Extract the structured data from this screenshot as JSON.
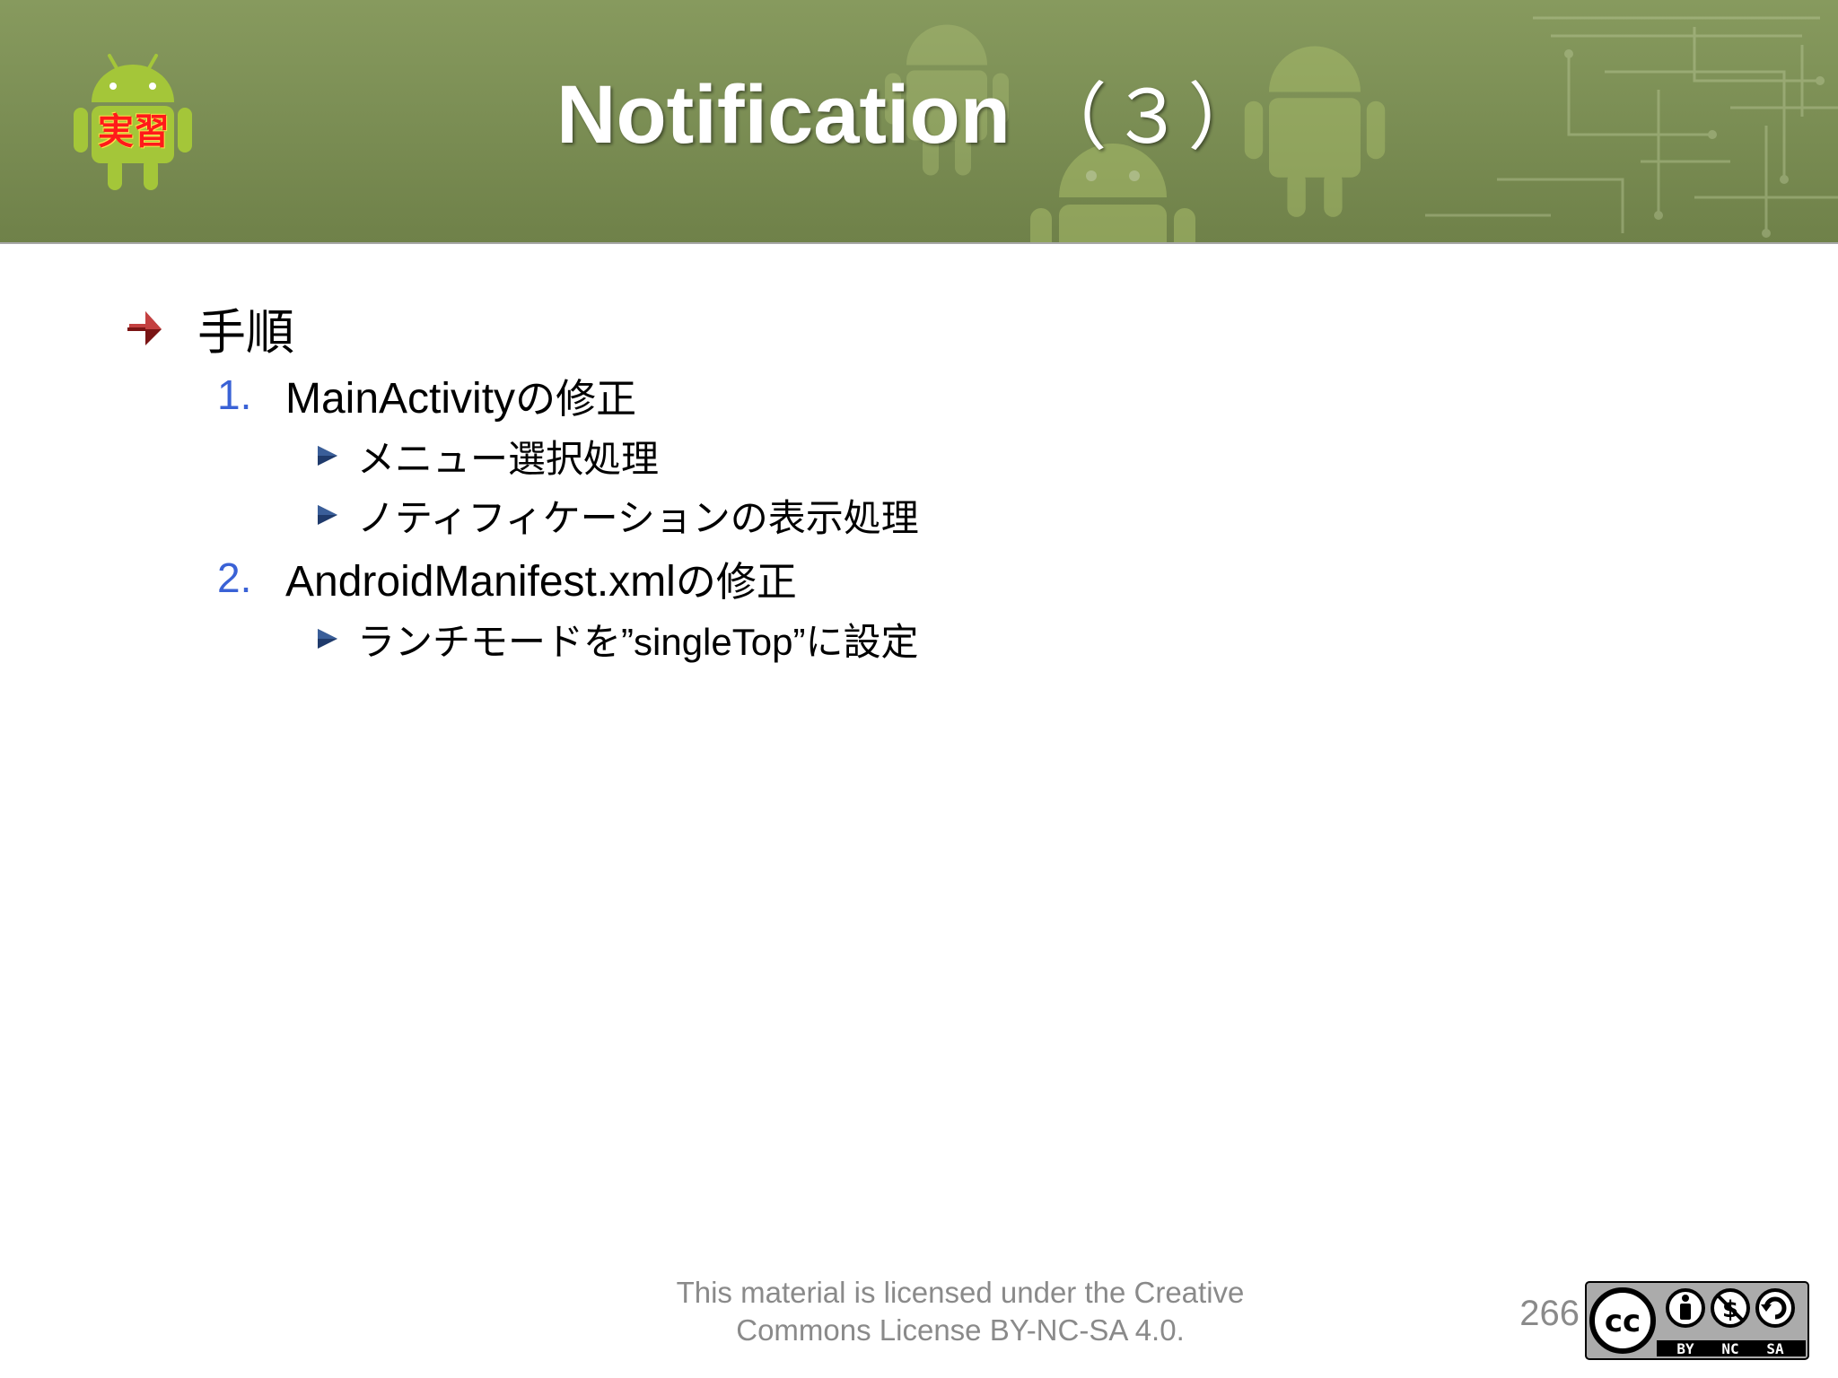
{
  "slide": {
    "title_main": "Notification",
    "title_paren": "（３）",
    "logo_label": "実習",
    "main_bullet": "手順",
    "items": [
      {
        "number": "1.",
        "latin": "MainActivity",
        "jp": "の修正",
        "subs": [
          {
            "text": "メニュー選択処理"
          },
          {
            "text": "ノティフィケーションの表示処理"
          }
        ]
      },
      {
        "number": "2.",
        "latin": "AndroidManifest.xml",
        "jp": "の修正",
        "subs": [
          {
            "pre": "ランチモードを",
            "latin": "”singleTop”",
            "post": "に設定"
          }
        ]
      }
    ]
  },
  "footer": {
    "license_line1": "This material is licensed under the Creative",
    "license_line2": "Commons License BY-NC-SA 4.0.",
    "page_number": "266",
    "badge": {
      "cc": "cc",
      "by": "BY",
      "nc": "NC",
      "sa": "SA"
    }
  },
  "colors": {
    "header_green": "#7c8f55",
    "android_green": "#a4c639",
    "number_blue": "#3a62d6",
    "bullet_dark_red": "#6b1010",
    "sub_bullet_navy": "#1f3a6b",
    "footer_gray": "#8a8a8a"
  },
  "icons": {
    "logo": "android-robot-icon",
    "main_bullet": "arrow-bullet-icon",
    "sub_bullet": "triangle-bullet-icon",
    "license": "creative-commons-by-nc-sa-icon"
  }
}
